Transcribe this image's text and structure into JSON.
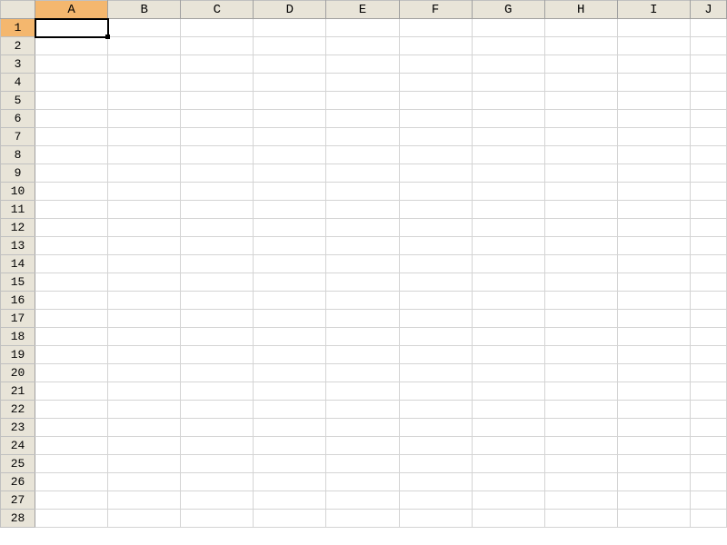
{
  "columns": [
    "A",
    "B",
    "C",
    "D",
    "E",
    "F",
    "G",
    "H",
    "I",
    "J"
  ],
  "rows": [
    "1",
    "2",
    "3",
    "4",
    "5",
    "6",
    "7",
    "8",
    "9",
    "10",
    "11",
    "12",
    "13",
    "14",
    "15",
    "16",
    "17",
    "18",
    "19",
    "20",
    "21",
    "22",
    "23",
    "24",
    "25",
    "26",
    "27",
    "28"
  ],
  "selectedColumn": "A",
  "selectedRow": "1",
  "activeCell": {
    "col": "A",
    "row": "1"
  },
  "colors": {
    "headerBg": "#e8e4d8",
    "selectedHeaderBg": "#f4b76e",
    "cellBg": "#ffffff",
    "gridLine": "#d4d4d4",
    "headerBorder": "#a0a0a0",
    "activeOutline": "#000000"
  }
}
